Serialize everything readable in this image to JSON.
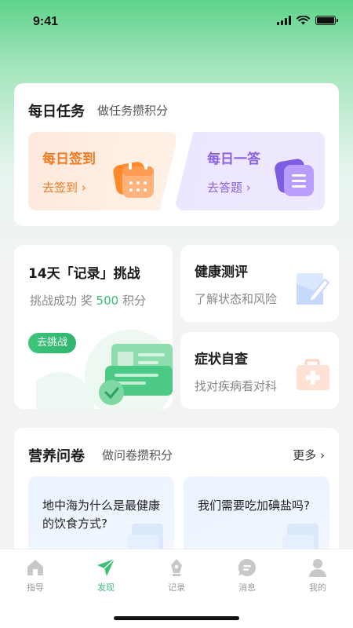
{
  "status": {
    "time": "9:41"
  },
  "daily": {
    "title": "每日任务",
    "subtitle": "做任务攒积分",
    "checkin": {
      "title": "每日签到",
      "link": "去签到 ›",
      "color": "#f07a22"
    },
    "answer": {
      "title": "每日一答",
      "link": "去答题 ›",
      "color": "#8b63e0"
    }
  },
  "challenge": {
    "title": "14天「记录」挑战",
    "sub_prefix": "挑战成功 奖 ",
    "points": "500",
    "sub_suffix": " 积分",
    "button": "去挑战"
  },
  "assessment": {
    "title": "健康测评",
    "subtitle": "了解状态和风险"
  },
  "symptom": {
    "title": "症状自查",
    "subtitle": "找对疾病看对科"
  },
  "nutrition": {
    "title": "营养问卷",
    "subtitle": "做问卷攒积分",
    "more": "更多 ›",
    "items": [
      {
        "text": "地中海为什么是最健康的饮食方式?"
      },
      {
        "text": "我们需要吃加碘盐吗?"
      }
    ]
  },
  "tabs": [
    {
      "label": "指导",
      "icon": "home-icon",
      "active": false
    },
    {
      "label": "发现",
      "icon": "send-icon",
      "active": true
    },
    {
      "label": "记录",
      "icon": "pen-icon",
      "active": false
    },
    {
      "label": "消息",
      "icon": "chat-icon",
      "active": false
    },
    {
      "label": "我的",
      "icon": "user-icon",
      "active": false
    }
  ],
  "colors": {
    "accent": "#3cbf76",
    "inactive": "#c8c8c8"
  }
}
